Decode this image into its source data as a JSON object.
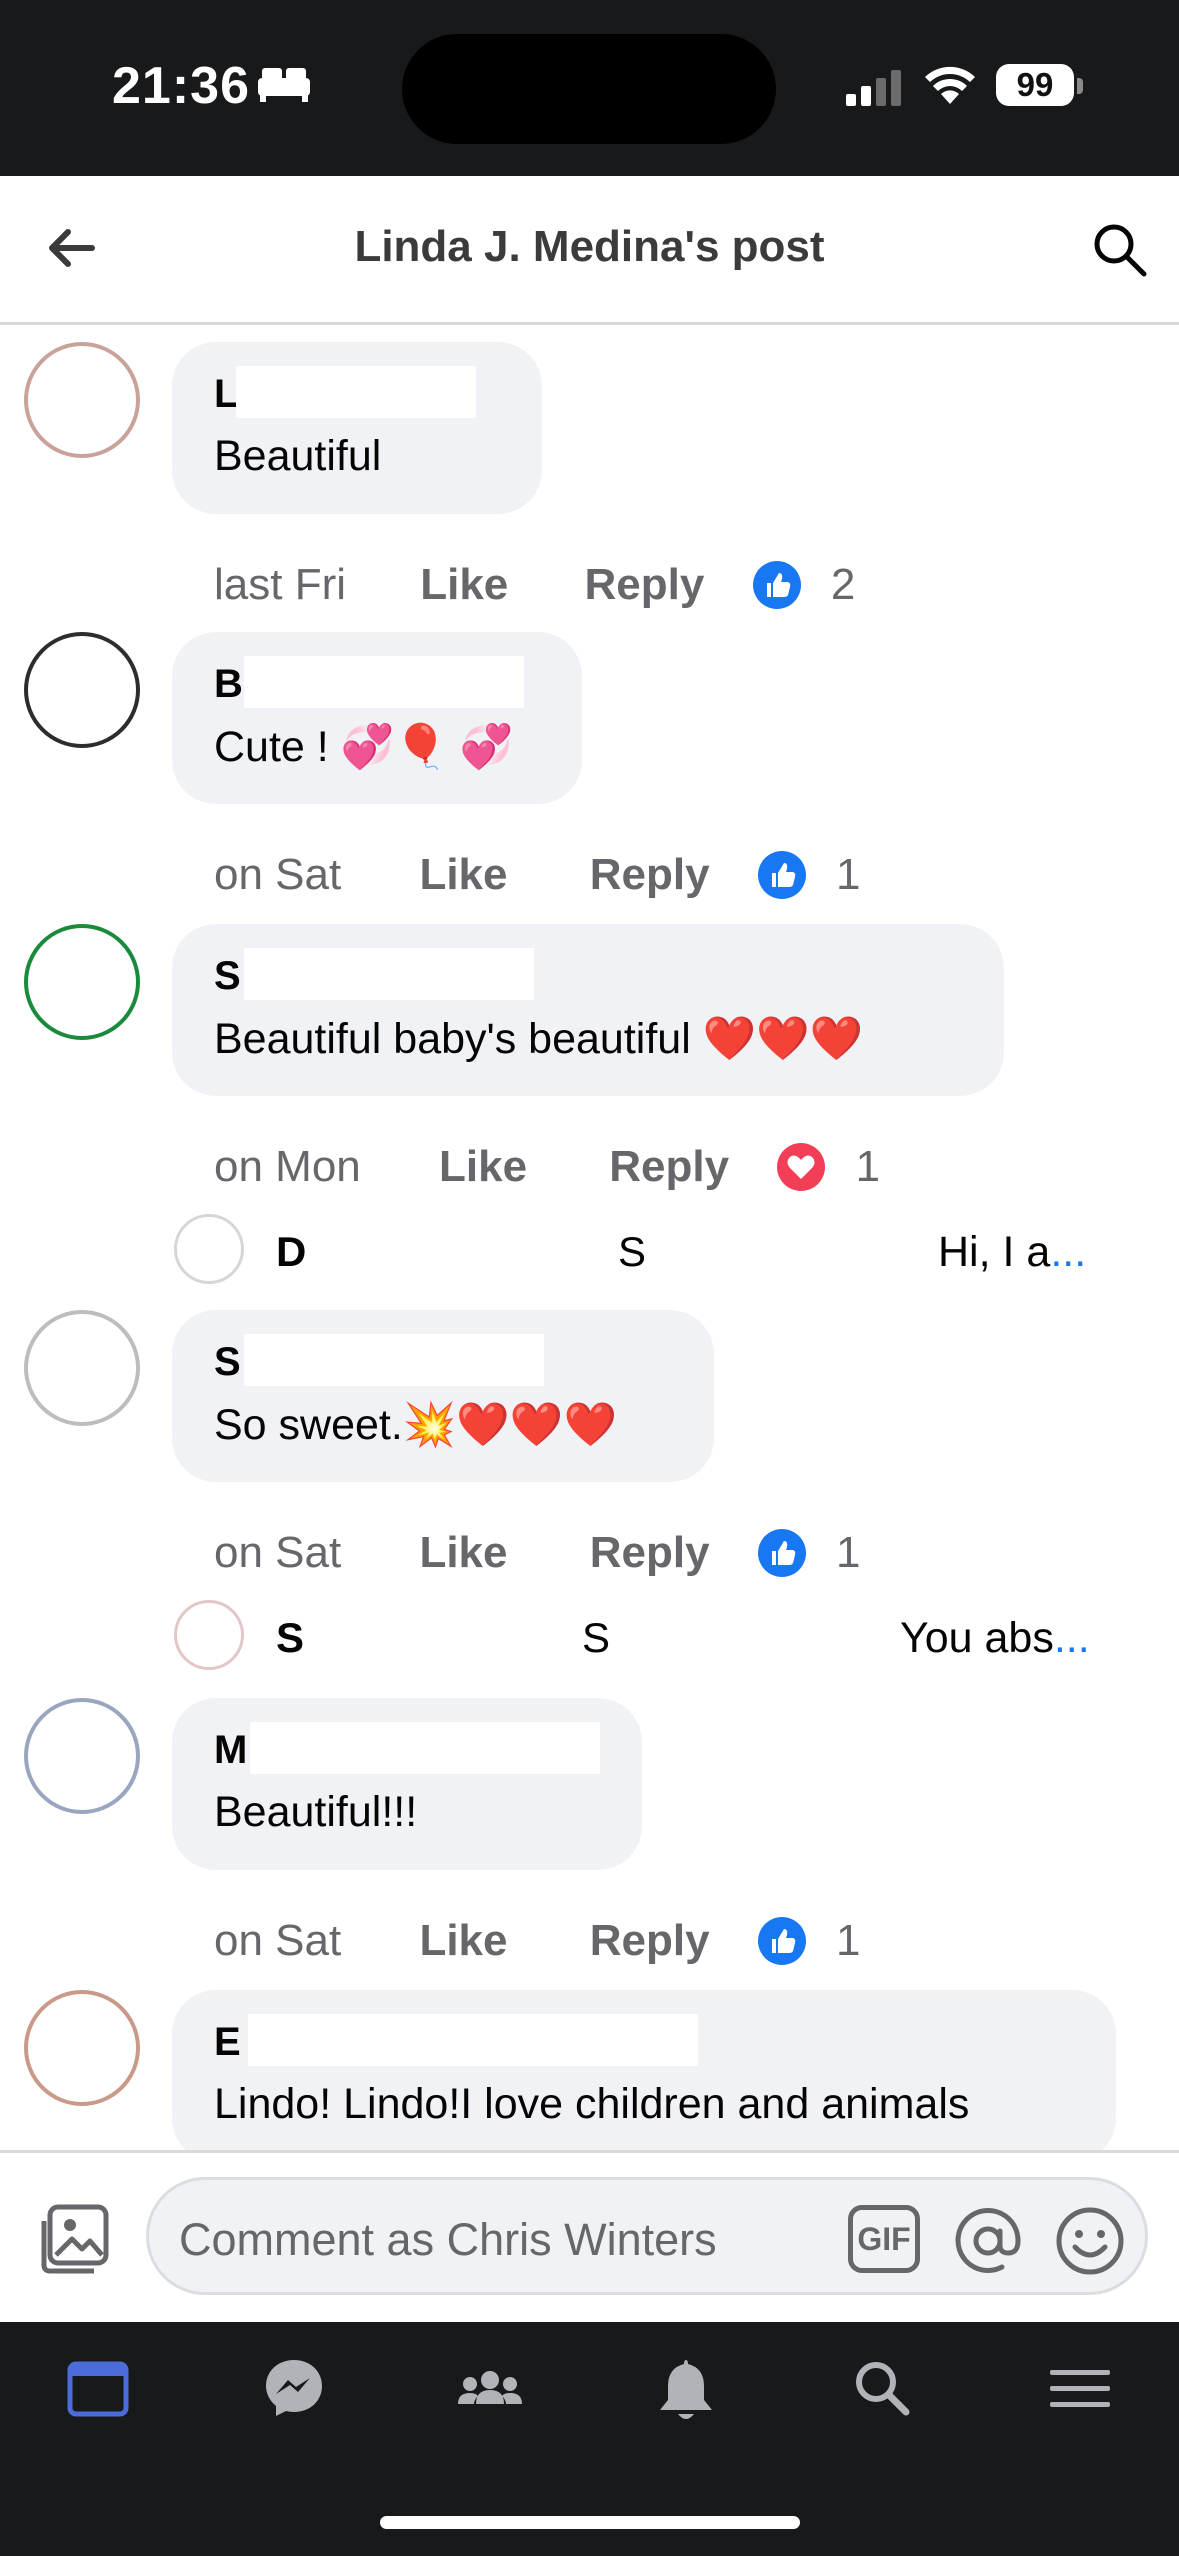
{
  "status_bar": {
    "time": "21:36",
    "battery": "99"
  },
  "header": {
    "title": "Linda J. Medina's post"
  },
  "comments": [
    {
      "author": "L",
      "text": "Beautiful",
      "time": "last Fri",
      "like": "Like",
      "reply": "Reply",
      "reaction": "like",
      "count": "2"
    },
    {
      "author": "B",
      "text": "Cute ! 💞🎈 💞",
      "time": "on Sat",
      "like": "Like",
      "reply": "Reply",
      "reaction": "like",
      "count": "1"
    },
    {
      "author": "S",
      "text": "Beautiful baby's beautiful ❤️❤️❤️",
      "time": "on Mon",
      "like": "Like",
      "reply": "Reply",
      "reaction": "love",
      "count": "1",
      "reply_preview": {
        "name": "D",
        "text_start": "S",
        "text_end": "Hi, I a",
        "more": "..."
      }
    },
    {
      "author": "S",
      "text": "So sweet.💥❤️❤️❤️",
      "time": "on Sat",
      "like": "Like",
      "reply": "Reply",
      "reaction": "like",
      "count": "1",
      "reply_preview": {
        "name": "S",
        "text_start": "S",
        "text_end": "You abs",
        "more": "..."
      }
    },
    {
      "author": "M",
      "text": "Beautiful!!!",
      "time": "on Sat",
      "like": "Like",
      "reply": "Reply",
      "reaction": "like",
      "count": "1"
    },
    {
      "author": "E",
      "text": "Lindo! Lindo!I love children and  animals"
    }
  ],
  "composer": {
    "placeholder": "Comment as Chris Winters",
    "gif_label": "GIF"
  },
  "tabs": [
    "home-icon",
    "messenger-icon",
    "groups-icon",
    "notifications-icon",
    "search-icon",
    "menu-icon"
  ],
  "colors": {
    "accent": "#1877f2",
    "love": "#f33e58",
    "bubble": "#f0f2f5",
    "dark": "#18191a"
  }
}
